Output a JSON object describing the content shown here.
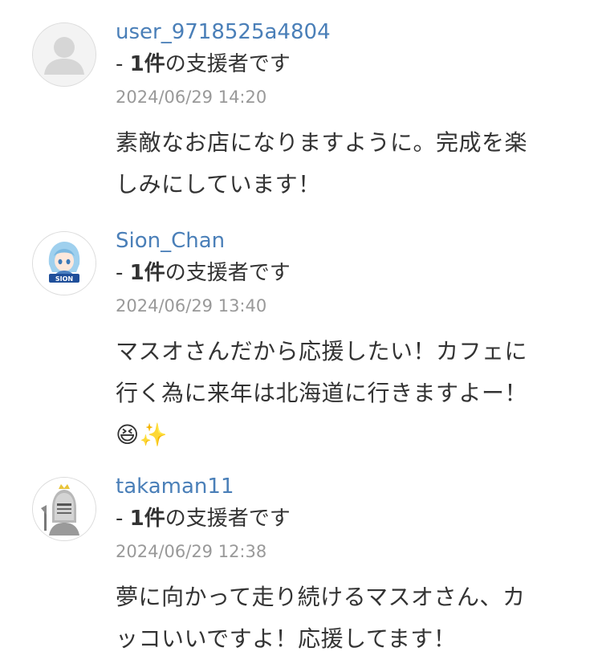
{
  "comments": [
    {
      "username": "user_9718525a4804",
      "support_prefix": "- ",
      "support_count": "1件",
      "support_suffix": "の支援者です",
      "date": "2024/06/29 14:20",
      "lines": [
        "素敵なお店になりますように。完成を楽",
        "しみにしています！"
      ],
      "avatar_icon": "default-user-icon"
    },
    {
      "username": "Sion_Chan",
      "support_prefix": "- ",
      "support_count": "1件",
      "support_suffix": "の支援者です",
      "date": "2024/06/29 13:40",
      "lines": [
        "マスオさんだから応援したい！カフェに",
        "行く為に来年は北海道に行きますよー！",
        "😆✨"
      ],
      "avatar_icon": "anime-character-avatar",
      "avatar_text": "SION"
    },
    {
      "username": "takaman11",
      "support_prefix": "- ",
      "support_count": "1件",
      "support_suffix": "の支援者です",
      "date": "2024/06/29 12:38",
      "lines": [
        "夢に向かって走り続けるマスオさん、カ",
        "ッコいいですよ！応援してます！"
      ],
      "avatar_icon": "knight-helmet-avatar"
    }
  ]
}
